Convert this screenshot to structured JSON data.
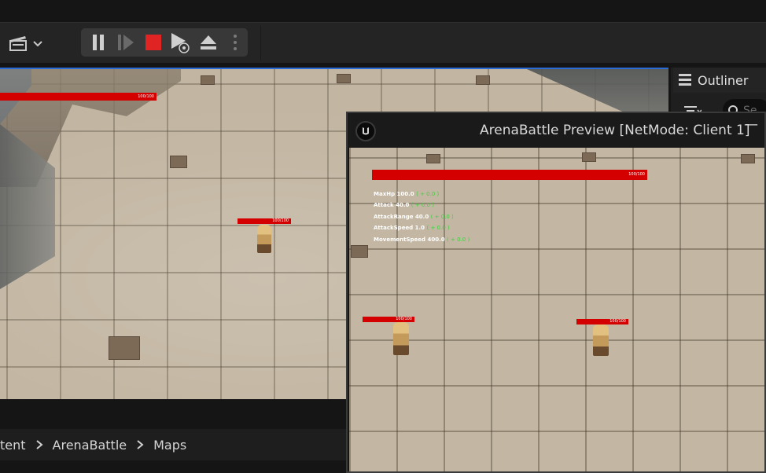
{
  "toolbar": {
    "cinematics_icon": "clapperboard-icon",
    "play_controls": [
      "pause-icon",
      "resume-icon",
      "stop-icon",
      "possess-eject-icon",
      "eject-icon",
      "kebab-menu-icon"
    ],
    "stop_color": "#e02424"
  },
  "main_viewport": {
    "player_health": "100/100",
    "npc_health": "100/100"
  },
  "outliner": {
    "title": "Outliner",
    "search_placeholder": "Se"
  },
  "breadcrumb": {
    "items": [
      "tent",
      "ArenaBattle",
      "Maps"
    ]
  },
  "pie_window": {
    "title": "ArenaBattle Preview [NetMode: Client 1]",
    "minimize_glyph": "—",
    "player_health": "100/100",
    "char1_health": "100/100",
    "char2_health": "100/100",
    "stats": [
      {
        "label": "MaxHp",
        "value": "100.0",
        "mod": "( + 0.0 )"
      },
      {
        "label": "Attack",
        "value": "40.0",
        "mod": "( + 0.0 )"
      },
      {
        "label": "AttackRange",
        "value": "40.0",
        "mod": "( + 0.0 )"
      },
      {
        "label": "AttackSpeed",
        "value": "1.0",
        "mod": "( + 0.0 )"
      },
      {
        "label": "MovementSpeed",
        "value": "400.0",
        "mod": "( + 0.0 )"
      }
    ]
  },
  "colors": {
    "health_bar": "#d40000",
    "accent_blue": "#2a6bd6",
    "stat_mod_green": "#40d040"
  }
}
